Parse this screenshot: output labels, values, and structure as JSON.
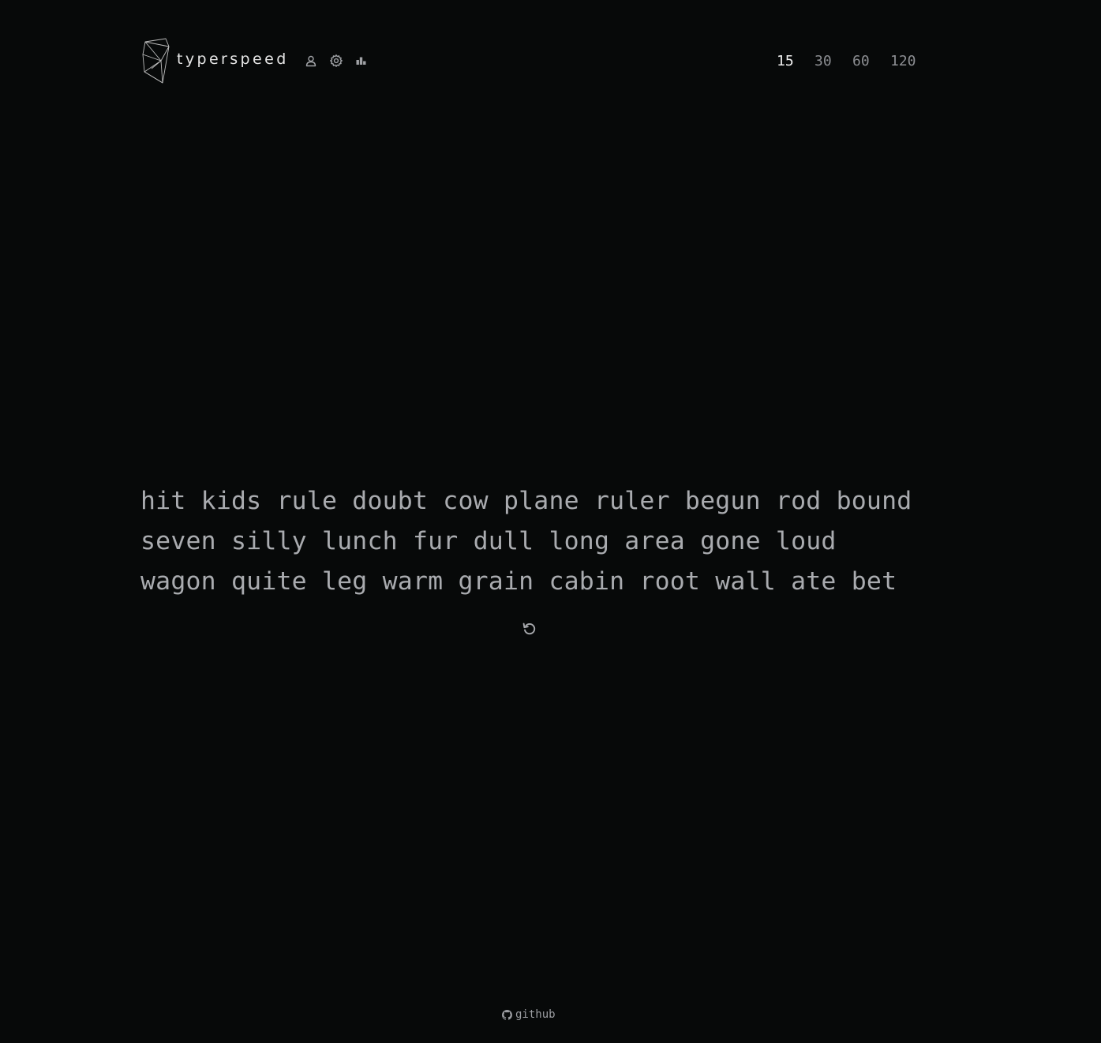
{
  "app": {
    "brand": "typerspeed"
  },
  "nav_icons": [
    "user-icon",
    "gear-icon",
    "stats-icon"
  ],
  "durations": {
    "options": [
      "15",
      "30",
      "60",
      "120"
    ],
    "selected": "15"
  },
  "words": {
    "lines": [
      "hit kids rule doubt cow plane ruler begun rod bound",
      "seven silly lunch fur dull long area gone loud",
      "wagon quite leg warm grain cabin root wall ate bet"
    ]
  },
  "restart_icon": "restart-icon",
  "footer": {
    "icon": "github-icon",
    "label": "github"
  },
  "colors": {
    "background": "#070909",
    "text_active": "#f0f0f0",
    "text_muted": "#8c8e92",
    "words": "#a9abaf"
  }
}
